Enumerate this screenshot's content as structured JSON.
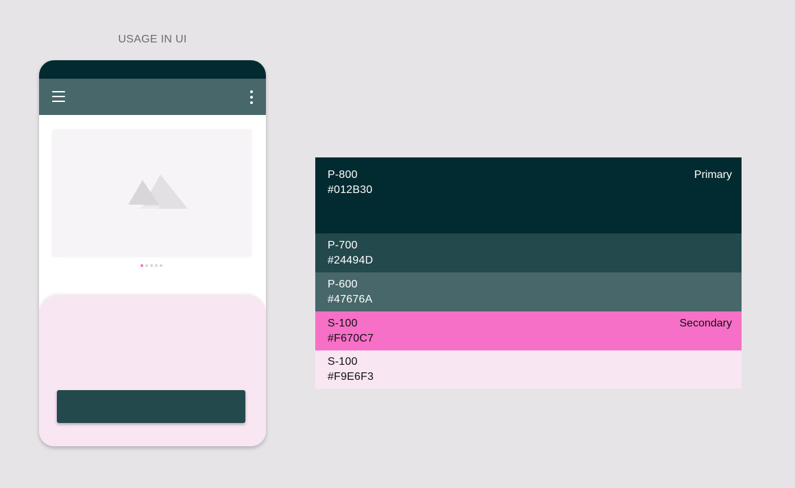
{
  "usage": {
    "title": "USAGE IN UI"
  },
  "phone": {
    "icons": [
      "menu-icon",
      "more-vert-icon",
      "image-placeholder-icon"
    ],
    "carousel": {
      "page_count": 5,
      "active_page": 1
    }
  },
  "palette": {
    "swatches": [
      {
        "name": "P-800",
        "hex": "#012B30",
        "group": "Primary",
        "color": "#012b30"
      },
      {
        "name": "P-700",
        "hex": "#24494D",
        "color": "#24494d"
      },
      {
        "name": "P-600",
        "hex": "#47676A",
        "color": "#47676a"
      },
      {
        "name": "S-100",
        "hex": "#F670C7",
        "group": "Secondary",
        "color": "#f670c7"
      },
      {
        "name": "S-100",
        "hex": "#F9E6F3",
        "color": "#f9e6f3"
      }
    ]
  }
}
